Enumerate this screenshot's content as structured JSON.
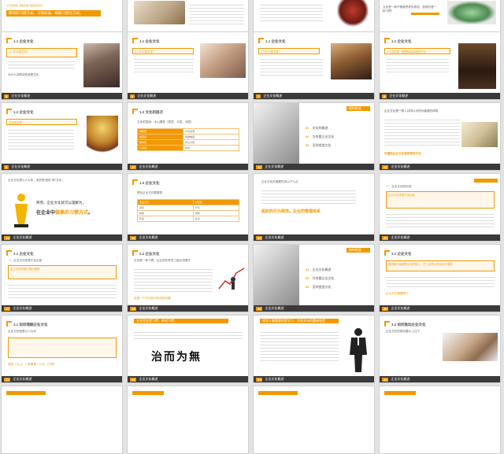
{
  "app": {
    "name": "PowerPoint slide sorter"
  },
  "colors": {
    "accent": "#f39800",
    "bar": "#3a3a3a",
    "background": "#e3e3e3"
  },
  "footer_label": "企业文化概述",
  "slides": [
    {
      "id": 1,
      "num": "1",
      "title": "",
      "main_text": "影响的习惯方式、习惯标准、根据习惯化方式。",
      "sub_text": "心灵的体验  活动标准习惯化的方式"
    },
    {
      "id": 2,
      "num": "2",
      "title": "",
      "main_text": "",
      "sub_text": ""
    },
    {
      "id": 3,
      "num": "3",
      "title": "",
      "main_text": "",
      "sub_text": ""
    },
    {
      "id": 4,
      "num": "4",
      "title": "",
      "main_text": "文化是一种不需要思考的表现，表现的是一种习惯！",
      "sub_text": ""
    },
    {
      "id": 5,
      "num": "5",
      "title": "1.1 企业文化",
      "main_text": "1.1 什么是文化？",
      "sub_text": "为什么说群体性就是文化"
    },
    {
      "id": 6,
      "num": "6",
      "title": "1.1 企业文化",
      "main_text": "1.2 什么是文化？",
      "sub_text": ""
    },
    {
      "id": 7,
      "num": "7",
      "title": "1.1 企业文化",
      "main_text": "1.3 什么是文化？",
      "sub_text": ""
    },
    {
      "id": 8,
      "num": "8",
      "title": "1.1 企业文化",
      "main_text": "1.4 文化是一种群体性的组织行为",
      "sub_text": ""
    },
    {
      "id": 9,
      "num": "9",
      "title": "1.2 企业文化",
      "main_text": "文化的本质",
      "sub_text": ""
    },
    {
      "id": 10,
      "num": "10",
      "title": "1.2 文化的层次",
      "main_text": "文化的层面：冰山模型（表层、中层、深层）",
      "sub_text": "",
      "table": [
        [
          "物质层",
          "行为表现"
        ],
        [
          "制度层",
          "规章制度"
        ],
        [
          "精神层",
          "核心价值"
        ],
        [
          "心理层",
          "信念"
        ]
      ]
    },
    {
      "id": 11,
      "num": "11",
      "title": "",
      "main_text": "",
      "sub_text": "",
      "side_label": "结构框架",
      "items": [
        {
          "n": "01",
          "label": "文化的概述"
        },
        {
          "n": "02",
          "label": "为何要企业文化"
        },
        {
          "n": "03",
          "label": "怎样塑造文化"
        }
      ]
    },
    {
      "id": 12,
      "num": "12",
      "title": "",
      "main_text": "企业文化是一群人共同认可的价值观的体现",
      "sub_text": "中国的企业文化是领导的文化",
      "side_label": ""
    },
    {
      "id": 13,
      "num": "13",
      "title": "",
      "main_text": "企业文化是以人为本，说的是“团队”和“文化”。",
      "sub_text": "简而：企业文化就是习惯力量的一种表现",
      "big_line1": "简而，企业文化就可以理解为，",
      "big_line2a": "在企业中",
      "big_line2b": "做事的习惯方式",
      "big_line2c": "。"
    },
    {
      "id": 14,
      "num": "14",
      "title": "1.3 企业文化",
      "main_text": "理论企业文化要素表",
      "sub_text": "",
      "table": [
        [
          "企业文化",
          "价值观"
        ],
        [
          "目标",
          "行为"
        ],
        [
          "制度",
          "形象"
        ],
        [
          "环境",
          "标识"
        ]
      ]
    },
    {
      "id": 15,
      "num": "15",
      "title": "",
      "main_text": "企业文化的重要性有以下几点",
      "highlight_a": "组织的行为规范",
      "highlight_b": "企业的管理体系"
    },
    {
      "id": 16,
      "num": "16",
      "title": "",
      "main_text": "一、企业文化的形成",
      "sub_text": "企业文化来源于创业者"
    },
    {
      "id": 17,
      "num": "17",
      "title": "2.1 企业文化",
      "main_text": "一、企业文化来源于创业者",
      "sub_text": "企业文化的核心是价值观"
    },
    {
      "id": 18,
      "num": "18",
      "title": "2.2 企业文化",
      "main_text": "文化是一种习惯，企业的所有员工都必须遵守",
      "sub_text": "这是一个文化如何形成的问题"
    },
    {
      "id": 19,
      "num": "19",
      "title": "",
      "main_text": "",
      "sub_text": "",
      "side_label": "结构框架",
      "items": [
        {
          "n": "01",
          "label": "企业文化概述"
        },
        {
          "n": "02",
          "label": "为何要企业文化"
        },
        {
          "n": "03",
          "label": "怎样塑造文化"
        }
      ]
    },
    {
      "id": 20,
      "num": "20",
      "title": "3.1 企业文化",
      "main_text": "理念和价值观是企业的核心，员工必须认同企业价值观",
      "sub_text": "企业文化需要践行"
    },
    {
      "id": 21,
      "num": "21",
      "title": "3.1 如何理解企业文化",
      "main_text": "企业文化就是以人为本",
      "sub_text": "理念（人心）一种管理 + 行为（习惯）"
    },
    {
      "id": 22,
      "num": "22",
      "title": "",
      "main_text": "文化完全是习惯，养成习惯。",
      "calligraphy": "治而为無"
    },
    {
      "id": 23,
      "num": "23",
      "title": "",
      "main_text": "领导人最重要的是学习，实现文化的重新塑造",
      "sub_text": ""
    },
    {
      "id": 24,
      "num": "24",
      "title": "3.2 如何推动企业文化",
      "main_text": "企业文化的推动要从上往下",
      "sub_text": ""
    },
    {
      "id": 25,
      "num": "25",
      "title": "",
      "main_text": "",
      "sub_text": ""
    },
    {
      "id": 26,
      "num": "26",
      "title": "",
      "main_text": "",
      "sub_text": ""
    },
    {
      "id": 27,
      "num": "27",
      "title": "",
      "main_text": "",
      "sub_text": ""
    },
    {
      "id": 28,
      "num": "28",
      "title": "",
      "main_text": "",
      "sub_text": ""
    }
  ]
}
